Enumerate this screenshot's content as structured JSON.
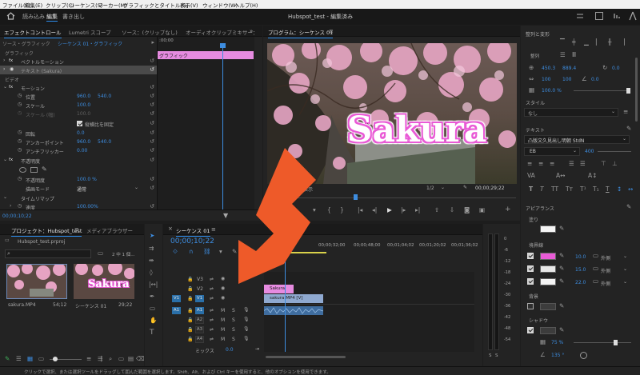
{
  "menubar": {
    "items": [
      "ファイル(F)",
      "編集(E)",
      "クリップ(C)",
      "シーケンス(S)",
      "マーカー(M)",
      "グラフィックとタイトル(G)",
      "表示(V)",
      "ウィンドウ(W)",
      "ヘルプ(H)"
    ]
  },
  "header": {
    "workspaces": [
      "読み込み",
      "編集",
      "書き出し"
    ],
    "active": "編集",
    "project_title": "Hubspot_test - 編集済み"
  },
  "effect_controls": {
    "tabs": [
      "エフェクトコントロール",
      "Lumetri スコープ",
      "ソース：(クリップなし)",
      "オーディオクリップミキサー："
    ],
    "source_label": "ソース・グラフィック",
    "sequence_label": "シーケンス 01・グラフィック",
    "clip_ruler": ":00;00",
    "clip_label": "グラフィック",
    "timecode": "00;00;10;22",
    "rows": {
      "graphic": "グラフィック",
      "vector_motion": "ベクトルモーション",
      "text_layer": "テキスト (Sakura)",
      "video": "ビデオ",
      "motion": "モーション",
      "position": "位置",
      "position_x": "960.0",
      "position_y": "540.0",
      "scale": "スケール",
      "scale_value": "100.0",
      "scale_width": "スケール (幅)",
      "scale_width_value": "100.0",
      "uniform_scale": "縦横比を固定",
      "rotation": "回転",
      "rotation_value": "0.0",
      "anchor": "アンカーポイント",
      "anchor_x": "960.0",
      "anchor_y": "540.0",
      "antiflicker": "アンチフリッカー",
      "antiflicker_value": "0.00",
      "opacity": "不透明度",
      "opacity_label": "不透明度",
      "opacity_value": "100.0 %",
      "blend_mode": "描画モード",
      "blend_value": "通常",
      "time_remap": "タイムリマップ",
      "speed": "速度",
      "speed_value": "100.00%"
    }
  },
  "program": {
    "tab": "プログラム：シーケンス 01",
    "title_text": "Sakura",
    "fit": "全体表示",
    "quality": "1/2",
    "end_timecode": "00;00;29;22"
  },
  "project": {
    "tabs": [
      "プロジェクト：Hubspot_test",
      "メディアブラウザー"
    ],
    "filename": "Hubspot_test.prproj",
    "selection_info": "2 中 1 個...",
    "items": [
      {
        "name": "sakura.MP4",
        "duration": "54;12"
      },
      {
        "name": "シーケンス 01",
        "duration": "29;22",
        "thumb_text": "Sakura"
      }
    ]
  },
  "timeline": {
    "tab": "シーケンス 01",
    "timecode": "00;00;10;22",
    "ruler": [
      "00;00;32;00",
      "00;00;48;00",
      "00;01;04;02",
      "00;01;20;02",
      "00;01;36;02"
    ],
    "video_tracks": [
      "V3",
      "V2",
      "V1"
    ],
    "audio_tracks": [
      "A1",
      "A2",
      "A3",
      "A4"
    ],
    "source_video": "V1",
    "source_audio": "A1",
    "mix_label": "ミックス",
    "mix_value": "0.0",
    "clips": {
      "title": "Sakura",
      "video": "sakura.MP4 [V]"
    }
  },
  "meter": {
    "ticks": [
      "0",
      "-6",
      "-12",
      "-18",
      "-24",
      "-30",
      "-36",
      "-42",
      "-48",
      "-54"
    ],
    "footer": [
      "S",
      "S"
    ]
  },
  "essential_graphics": {
    "align_header": "整列と変形",
    "position_x": "450.3",
    "position_y": "889.4",
    "rotation": "0.0",
    "scale_w": "100",
    "scale_h": "100",
    "angle": "0.0",
    "opacity": "100.0 %",
    "style_header": "スタイル",
    "style_value": "なし",
    "text_header": "テキスト",
    "font_name": "凸版文久見出し明朝 StdN",
    "font_style": "EB",
    "font_size": "400",
    "appearance_header": "アピアランス",
    "fill_label": "塗り",
    "stroke_label": "境界線",
    "strokes": [
      {
        "color": "#e95bd6",
        "width": "10.0",
        "type": "外側"
      },
      {
        "color": "#e8e8e8",
        "width": "15.0",
        "type": "外側"
      },
      {
        "color": "#f4f4f4",
        "width": "22.0",
        "type": "外側"
      }
    ],
    "fill_color": "#f5f5f5",
    "bg_label": "背景",
    "shadow_label": "シャドウ",
    "shadow_opacity": "75 %",
    "shadow_angle": "135 °"
  },
  "status_bar": {
    "text": "クリックで選択、または選択ツールをドラッグして囲んだ範囲を選択します。Shift、Alt、および Ctrl キーを使用すると、他のオプションを使用できます。"
  },
  "colors": {
    "accent": "#2d8ceb",
    "title_clip": "#e68be0",
    "video_clip": "#8fa9d0",
    "arrow": "#ee5a29",
    "playhead": "#3d8de0"
  }
}
